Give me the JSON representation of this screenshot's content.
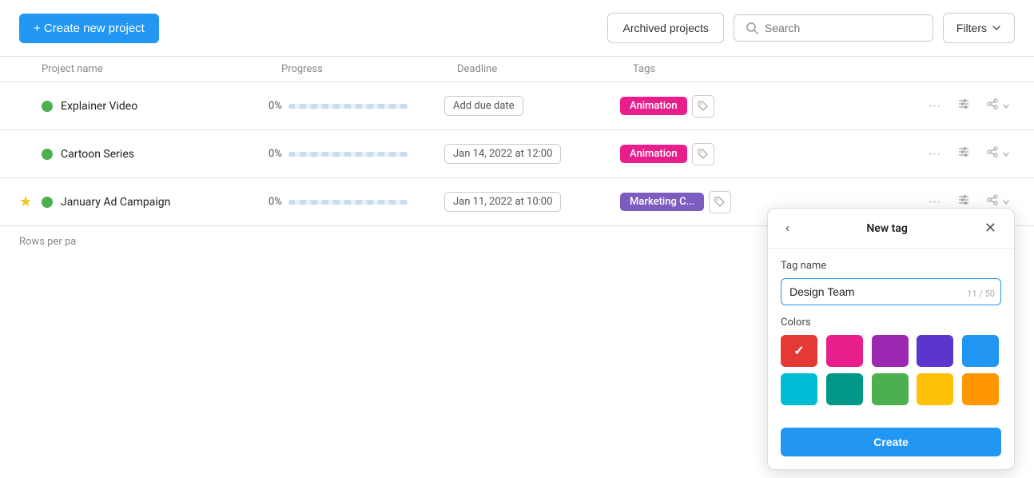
{
  "topBar": {
    "createBtn": "+ Create new project",
    "archivedBtn": "Archived projects",
    "searchPlaceholder": "Search",
    "filtersBtn": "Filters"
  },
  "table": {
    "headers": {
      "name": "Project name",
      "progress": "Progress",
      "deadline": "Deadline",
      "tags": "Tags"
    },
    "rows": [
      {
        "id": 1,
        "starred": false,
        "name": "Explainer Video",
        "progress": "0%",
        "deadline": "Add due date",
        "deadlineType": "add",
        "tags": [
          {
            "label": "Animation",
            "color": "animation"
          }
        ],
        "active": true
      },
      {
        "id": 2,
        "starred": false,
        "name": "Cartoon Series",
        "progress": "0%",
        "deadline": "Jan 14, 2022 at 12:00",
        "deadlineType": "set",
        "tags": [
          {
            "label": "Animation",
            "color": "animation"
          }
        ],
        "active": true
      },
      {
        "id": 3,
        "starred": true,
        "name": "January Ad Campaign",
        "progress": "0%",
        "deadline": "Jan 11, 2022 at 10:00",
        "deadlineType": "set",
        "tags": [
          {
            "label": "Marketing C...",
            "color": "marketing"
          }
        ],
        "active": true
      }
    ]
  },
  "rowsPerPage": "Rows per pa",
  "newTagPopup": {
    "title": "New tag",
    "tagNameLabel": "Tag name",
    "tagNameValue": "Design Team",
    "charCount": "11 / 50",
    "colorsLabel": "Colors",
    "colors": [
      {
        "hex": "#e53935",
        "selected": true
      },
      {
        "hex": "#e91e8c",
        "selected": false
      },
      {
        "hex": "#9c27b0",
        "selected": false
      },
      {
        "hex": "#5c35cc",
        "selected": false
      },
      {
        "hex": "#2196f3",
        "selected": false
      },
      {
        "hex": "#00bcd4",
        "selected": false
      },
      {
        "hex": "#009688",
        "selected": false
      },
      {
        "hex": "#4caf50",
        "selected": false
      },
      {
        "hex": "#ffc107",
        "selected": false
      },
      {
        "hex": "#ff9800",
        "selected": false
      }
    ],
    "createBtn": "Create"
  }
}
